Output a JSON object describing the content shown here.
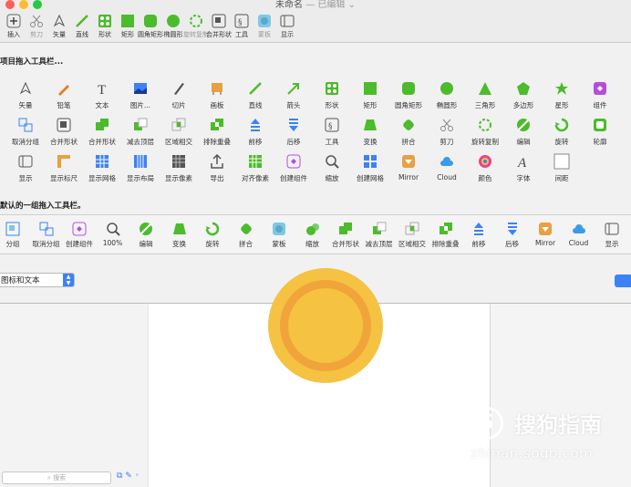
{
  "window": {
    "title": "未命名",
    "subtitle": "— 已编辑 ⌄"
  },
  "toolbar": [
    {
      "label": "插入",
      "icon": "plus-icon",
      "dim": false
    },
    {
      "label": "剪刀",
      "icon": "scissors-icon",
      "dim": true
    },
    {
      "label": "矢量",
      "icon": "pen-icon",
      "dim": false
    },
    {
      "label": "直线",
      "icon": "line-icon",
      "dim": false
    },
    {
      "label": "形状",
      "icon": "shape-icon",
      "dim": false
    },
    {
      "label": "矩形",
      "icon": "rectangle-icon",
      "dim": false
    },
    {
      "label": "圆角矩形",
      "icon": "rounded-rectangle-icon",
      "dim": false
    },
    {
      "label": "椭圆形",
      "icon": "oval-icon",
      "dim": false
    },
    {
      "label": "旋转复制",
      "icon": "rotate-copies-icon",
      "dim": true
    },
    {
      "label": "合并形状",
      "icon": "combine-shapes-icon",
      "dim": false
    },
    {
      "label": "工具",
      "icon": "tools-icon",
      "dim": false
    },
    {
      "label": "蒙板",
      "icon": "mask-icon",
      "dim": true
    },
    {
      "label": "显示",
      "icon": "view-icon",
      "dim": false
    }
  ],
  "customize": {
    "drag_items_heading": "项目拖入工具栏...",
    "drag_default_heading": "默认的一组拖入工具栏。",
    "items_row1": [
      {
        "label": "矢量",
        "icon": "pen-icon"
      },
      {
        "label": "铅笔",
        "icon": "pencil-icon"
      },
      {
        "label": "文本",
        "icon": "text-icon"
      },
      {
        "label": "图片...",
        "icon": "image-icon"
      },
      {
        "label": "切片",
        "icon": "slice-icon"
      },
      {
        "label": "画板",
        "icon": "artboard-icon"
      },
      {
        "label": "直线",
        "icon": "line-icon"
      },
      {
        "label": "箭头",
        "icon": "arrow-icon"
      },
      {
        "label": "形状",
        "icon": "shape-icon"
      },
      {
        "label": "矩形",
        "icon": "rectangle-icon"
      },
      {
        "label": "圆角矩形",
        "icon": "rounded-rectangle-icon"
      },
      {
        "label": "椭圆形",
        "icon": "oval-icon"
      },
      {
        "label": "三角形",
        "icon": "triangle-icon"
      },
      {
        "label": "多边形",
        "icon": "polygon-icon"
      },
      {
        "label": "星形",
        "icon": "star-icon"
      },
      {
        "label": "组件",
        "icon": "symbol-icon"
      }
    ],
    "items_row2": [
      {
        "label": "取消分组",
        "icon": "ungroup-icon"
      },
      {
        "label": "合并形状",
        "icon": "combine-icon"
      },
      {
        "label": "合并形状",
        "icon": "union-icon"
      },
      {
        "label": "减去顶层",
        "icon": "subtract-icon"
      },
      {
        "label": "区域相交",
        "icon": "intersect-icon"
      },
      {
        "label": "排除重叠",
        "icon": "difference-icon"
      },
      {
        "label": "前移",
        "icon": "forward-icon"
      },
      {
        "label": "后移",
        "icon": "backward-icon"
      },
      {
        "label": "工具",
        "icon": "tools-icon"
      },
      {
        "label": "变换",
        "icon": "transform-icon"
      },
      {
        "label": "拼合",
        "icon": "flatten-icon"
      },
      {
        "label": "剪刀",
        "icon": "scissors-icon"
      },
      {
        "label": "旋转复制",
        "icon": "rotate-copies-icon"
      },
      {
        "label": "编辑",
        "icon": "edit-icon"
      },
      {
        "label": "旋转",
        "icon": "rotate-icon"
      },
      {
        "label": "轮廓",
        "icon": "outline-icon"
      }
    ],
    "items_row3": [
      {
        "label": "显示",
        "icon": "view-icon"
      },
      {
        "label": "显示标尺",
        "icon": "rulers-icon"
      },
      {
        "label": "显示网格",
        "icon": "grid-icon"
      },
      {
        "label": "显示布局",
        "icon": "layout-icon"
      },
      {
        "label": "显示像素",
        "icon": "pixels-icon"
      },
      {
        "label": "导出",
        "icon": "export-icon"
      },
      {
        "label": "对齐像素",
        "icon": "align-pixels-icon"
      },
      {
        "label": "创建组件",
        "icon": "create-symbol-icon"
      },
      {
        "label": "缩放",
        "icon": "zoom-icon"
      },
      {
        "label": "创建网格",
        "icon": "make-grid-icon"
      },
      {
        "label": "Mirror",
        "icon": "mirror-icon"
      },
      {
        "label": "Cloud",
        "icon": "cloud-icon"
      },
      {
        "label": "颜色",
        "icon": "colors-icon"
      },
      {
        "label": "字体",
        "icon": "fonts-icon"
      },
      {
        "label": "间距",
        "icon": "space-icon"
      }
    ],
    "default_set": [
      {
        "label": "分组",
        "icon": "group-icon"
      },
      {
        "label": "取消分组",
        "icon": "ungroup-icon"
      },
      {
        "label": "创建组件",
        "icon": "create-symbol-icon"
      },
      {
        "label": "100%",
        "icon": "zoom-icon"
      },
      {
        "label": "编辑",
        "icon": "edit-icon"
      },
      {
        "label": "变换",
        "icon": "transform-icon"
      },
      {
        "label": "旋转",
        "icon": "rotate-icon"
      },
      {
        "label": "拼合",
        "icon": "flatten-icon"
      },
      {
        "label": "蒙板",
        "icon": "mask-icon"
      },
      {
        "label": "缩放",
        "icon": "scale-icon"
      },
      {
        "label": "合并形状",
        "icon": "union-icon"
      },
      {
        "label": "减去顶层",
        "icon": "subtract-icon"
      },
      {
        "label": "区域相交",
        "icon": "intersect-icon"
      },
      {
        "label": "排除重叠",
        "icon": "difference-icon"
      },
      {
        "label": "前移",
        "icon": "forward-icon"
      },
      {
        "label": "后移",
        "icon": "backward-icon"
      },
      {
        "label": "Mirror",
        "icon": "mirror-icon"
      },
      {
        "label": "Cloud",
        "icon": "cloud-icon"
      },
      {
        "label": "显示",
        "icon": "view-icon"
      }
    ],
    "show_select": "图标和文本"
  },
  "sidebar": {
    "search_placeholder": "搜索"
  },
  "watermark": {
    "text": "搜狗指南",
    "url": "zhinan.sogo.com"
  },
  "colors": {
    "accent": "#3b82f6",
    "green": "#4cbb2c",
    "sun": "#f5c242",
    "sun_ring": "#f0a43a"
  }
}
